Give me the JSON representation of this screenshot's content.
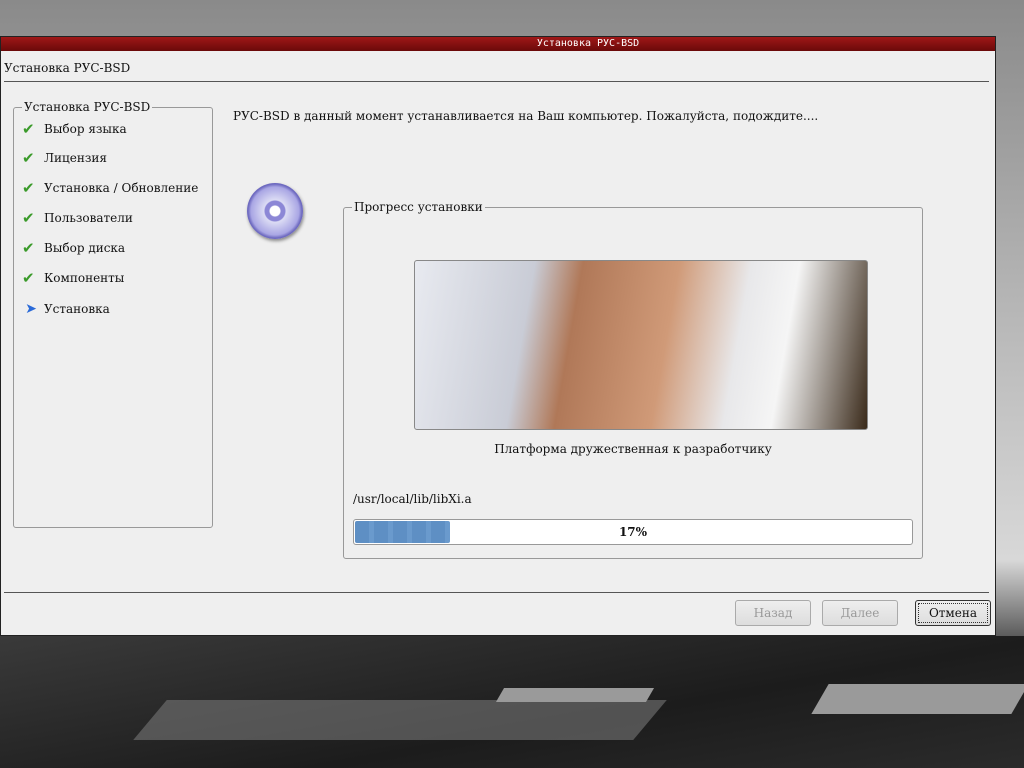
{
  "window": {
    "titlebar": "Установка РУС-BSD",
    "title": "Установка РУС-BSD"
  },
  "sidebar": {
    "legend": "Установка РУС-BSD",
    "steps": [
      {
        "label": "Выбор языка",
        "status": "done"
      },
      {
        "label": "Лицензия",
        "status": "done"
      },
      {
        "label": "Установка / Обновление",
        "status": "done"
      },
      {
        "label": "Пользователи",
        "status": "done"
      },
      {
        "label": "Выбор диска",
        "status": "done"
      },
      {
        "label": "Компоненты",
        "status": "done"
      },
      {
        "label": "Установка",
        "status": "current"
      }
    ]
  },
  "main": {
    "message": "РУС-BSD в данный момент устанавливается на Ваш компьютер. Пожалуйста, подождите....",
    "group_legend": "Прогресс установки",
    "caption": "Платформа дружественная к разработчику",
    "current_file": "/usr/local/lib/libXi.a",
    "progress_percent": 17,
    "progress_label": "17%"
  },
  "buttons": {
    "back": "Назад",
    "next": "Далее",
    "cancel": "Отмена"
  }
}
